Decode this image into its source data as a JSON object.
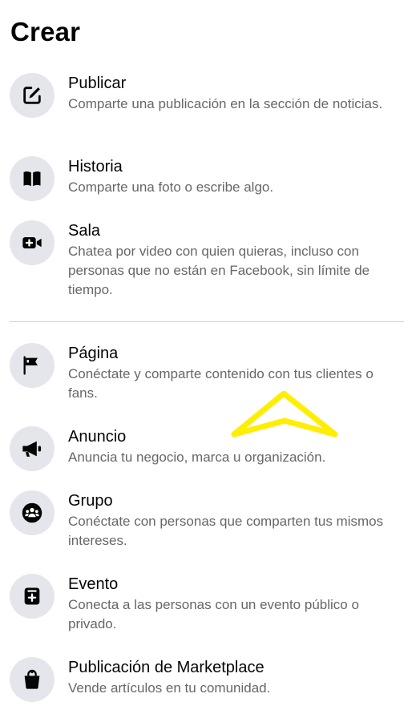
{
  "page": {
    "title": "Crear"
  },
  "items": [
    {
      "title": "Publicar",
      "desc": "Comparte una publicación en la sección de noticias.",
      "icon": "edit-icon"
    },
    {
      "title": "Historia",
      "desc": "Comparte una foto o escribe algo.",
      "icon": "book-icon"
    },
    {
      "title": "Sala",
      "desc": "Chatea por video con quien quieras, incluso con personas que no están en Facebook, sin límite de tiempo.",
      "icon": "video-plus-icon"
    },
    {
      "title": "Página",
      "desc": "Conéctate y comparte contenido con tus clientes o fans.",
      "icon": "flag-icon"
    },
    {
      "title": "Anuncio",
      "desc": "Anuncia tu negocio, marca u organización.",
      "icon": "megaphone-icon"
    },
    {
      "title": "Grupo",
      "desc": "Conéctate con personas que comparten tus mismos intereses.",
      "icon": "group-icon"
    },
    {
      "title": "Evento",
      "desc": "Conecta a las personas con un evento público o privado.",
      "icon": "calendar-plus-icon"
    },
    {
      "title": "Publicación de Marketplace",
      "desc": "Vende artículos en tu comunidad.",
      "icon": "shopping-bag-icon"
    }
  ],
  "colors": {
    "icon_bg": "#e4e6eb",
    "text_primary": "#050505",
    "text_secondary": "#65676b",
    "divider": "#ced0d4",
    "annotation": "#ffee00"
  }
}
